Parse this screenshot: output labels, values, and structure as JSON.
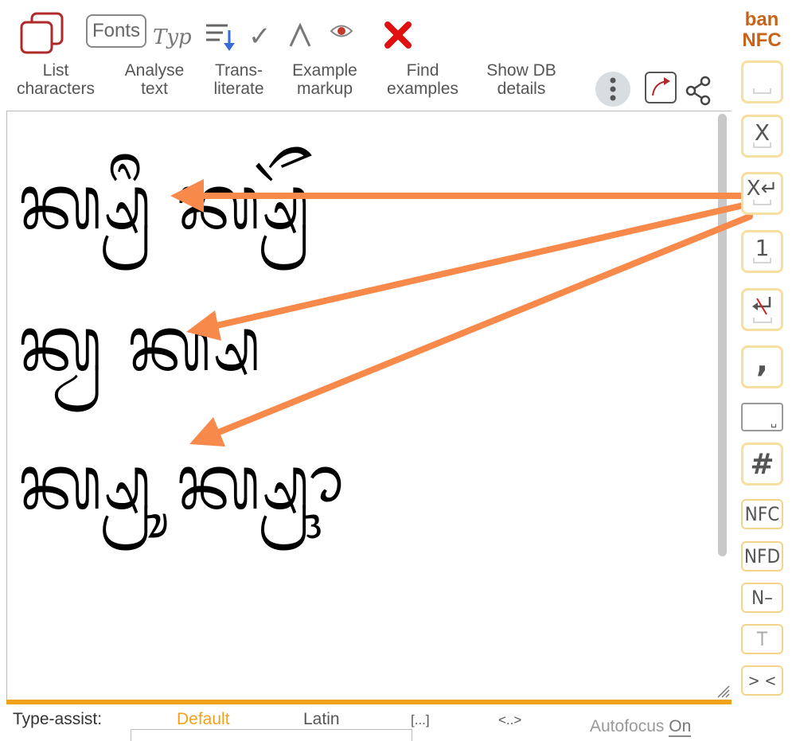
{
  "toolbar": {
    "list_label": "List\ncharacters",
    "fonts_label": "Fonts",
    "typ_label": "Typ",
    "analyse_label": "Analyse\ntext",
    "translit_label": "Trans-\nliterate",
    "markup_label": "Example\nmarkup",
    "find_label": "Find\nexamples",
    "db_label": "Show DB\ndetails"
  },
  "side": {
    "lang_top": "ban",
    "lang_bottom": "NFC",
    "btn_x": "X",
    "btn_xret": "X↵",
    "btn_one": "1",
    "btn_comma": ",",
    "btn_space": "␣",
    "btn_hash": "#",
    "btn_nfc": "NFC",
    "btn_nfd": "NFD",
    "btn_nminus": "N–",
    "btn_t": "T",
    "btn_gtlt": "> <"
  },
  "editor": {
    "line1": "ᬓ᭄ᬱ᭄ᬭᬷ ᬓ᭄ᬱ᭄ᬭᭂ",
    "line2": "ᬓ᭄ᬯ ᬓ᭄ᬱ",
    "line3": "ᬓ᭄ᬱ᭄ᬭᬸ ᬓ᭄ᬱ᭄ᬭᬹᬵ"
  },
  "typeassist": {
    "label": "Type-assist:",
    "default": "Default",
    "latin": "Latin",
    "bracket": "[...]",
    "angle": "<..>",
    "autofocus": "Autofocus",
    "autofocus_state": "On"
  },
  "colors": {
    "accent": "#f0a21b",
    "brand": "#c8641a",
    "arrow": "#f7894a",
    "close": "#e01010",
    "side_border": "#f6dfa0"
  }
}
